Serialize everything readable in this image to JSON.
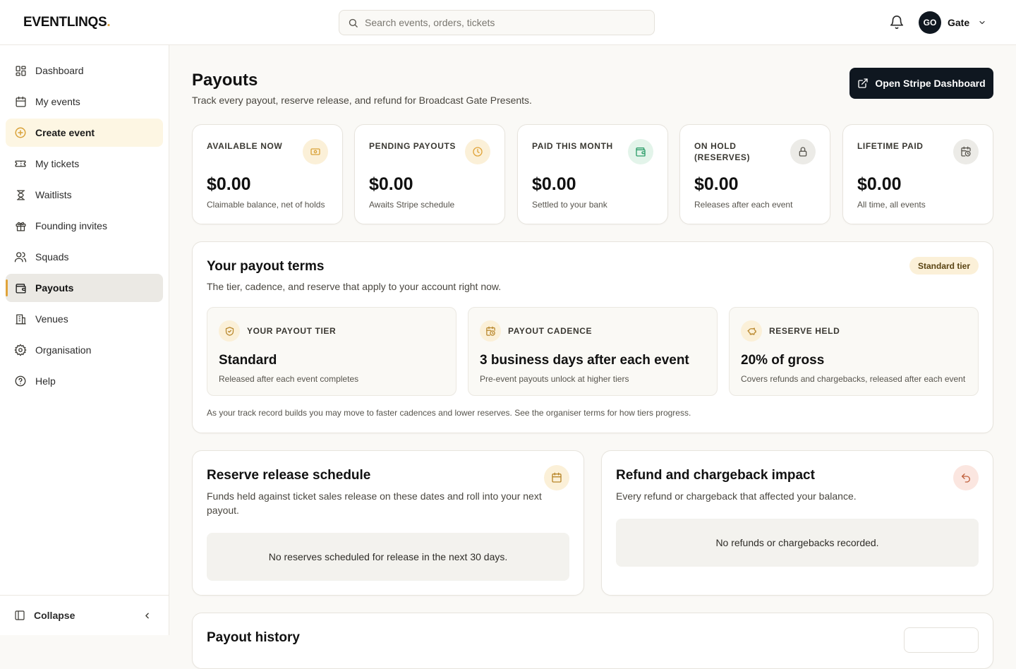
{
  "app": {
    "logo_text": "EVENTLINQS",
    "logo_dot": "."
  },
  "search": {
    "placeholder": "Search events, orders, tickets"
  },
  "user": {
    "initials": "GO",
    "name": "Gate"
  },
  "sidebar": {
    "items": [
      {
        "label": "Dashboard",
        "icon": "dashboard-icon"
      },
      {
        "label": "My events",
        "icon": "calendar-icon"
      },
      {
        "label": "Create event",
        "icon": "plus-circle-icon"
      },
      {
        "label": "My tickets",
        "icon": "ticket-icon"
      },
      {
        "label": "Waitlists",
        "icon": "hourglass-icon"
      },
      {
        "label": "Founding invites",
        "icon": "gift-icon"
      },
      {
        "label": "Squads",
        "icon": "users-icon"
      },
      {
        "label": "Payouts",
        "icon": "wallet-icon"
      },
      {
        "label": "Venues",
        "icon": "building-icon"
      },
      {
        "label": "Organisation",
        "icon": "gear-icon"
      },
      {
        "label": "Help",
        "icon": "help-icon"
      }
    ],
    "active": "Payouts",
    "collapse_label": "Collapse"
  },
  "page": {
    "title": "Payouts",
    "subtitle": "Track every payout, reserve release, and refund for Broadcast Gate Presents.",
    "stripe_button": "Open Stripe Dashboard"
  },
  "stats": [
    {
      "label": "AVAILABLE NOW",
      "value": "$0.00",
      "note": "Claimable balance, net of holds",
      "icon": "money-icon",
      "color": "#d9a23a",
      "bg": "#fbf0d8"
    },
    {
      "label": "PENDING PAYOUTS",
      "value": "$0.00",
      "note": "Awaits Stripe schedule",
      "icon": "clock-icon",
      "color": "#e0a43a",
      "bg": "#fbf0d8"
    },
    {
      "label": "PAID THIS MONTH",
      "value": "$0.00",
      "note": "Settled to your bank",
      "icon": "wallet-icon",
      "color": "#2f9e6b",
      "bg": "#e3f4ea"
    },
    {
      "label": "ON HOLD (RESERVES)",
      "value": "$0.00",
      "note": "Releases after each event",
      "icon": "lock-icon",
      "color": "#5a5750",
      "bg": "#ecebe7"
    },
    {
      "label": "LIFETIME PAID",
      "value": "$0.00",
      "note": "All time, all events",
      "icon": "calendar-clock-icon",
      "color": "#5a5750",
      "bg": "#ecebe7"
    }
  ],
  "terms": {
    "title": "Your payout terms",
    "subtitle": "The tier, cadence, and reserve that apply to your account right now.",
    "badge": "Standard tier",
    "cards": [
      {
        "label": "YOUR PAYOUT TIER",
        "value": "Standard",
        "note": "Released after each event completes",
        "icon": "shield-check-icon"
      },
      {
        "label": "PAYOUT CADENCE",
        "value": "3 business days after each event",
        "note": "Pre-event payouts unlock at higher tiers",
        "icon": "calendar-clock-icon"
      },
      {
        "label": "RESERVE HELD",
        "value": "20% of gross",
        "note": "Covers refunds and chargebacks, released after each event",
        "icon": "piggy-bank-icon"
      }
    ],
    "footnote": "As your track record builds you may move to faster cadences and lower reserves. See the organiser terms for how tiers progress."
  },
  "reserve": {
    "title": "Reserve release schedule",
    "subtitle": "Funds held against ticket sales release on these dates and roll into your next payout.",
    "empty": "No reserves scheduled for release in the next 30 days.",
    "icon": "calendar-icon"
  },
  "refunds": {
    "title": "Refund and chargeback impact",
    "subtitle": "Every refund or chargeback that affected your balance.",
    "empty": "No refunds or chargebacks recorded.",
    "icon": "undo-icon"
  },
  "history": {
    "title": "Payout history"
  },
  "colors": {
    "accent": "#e0a43a",
    "dark": "#0f1720"
  }
}
